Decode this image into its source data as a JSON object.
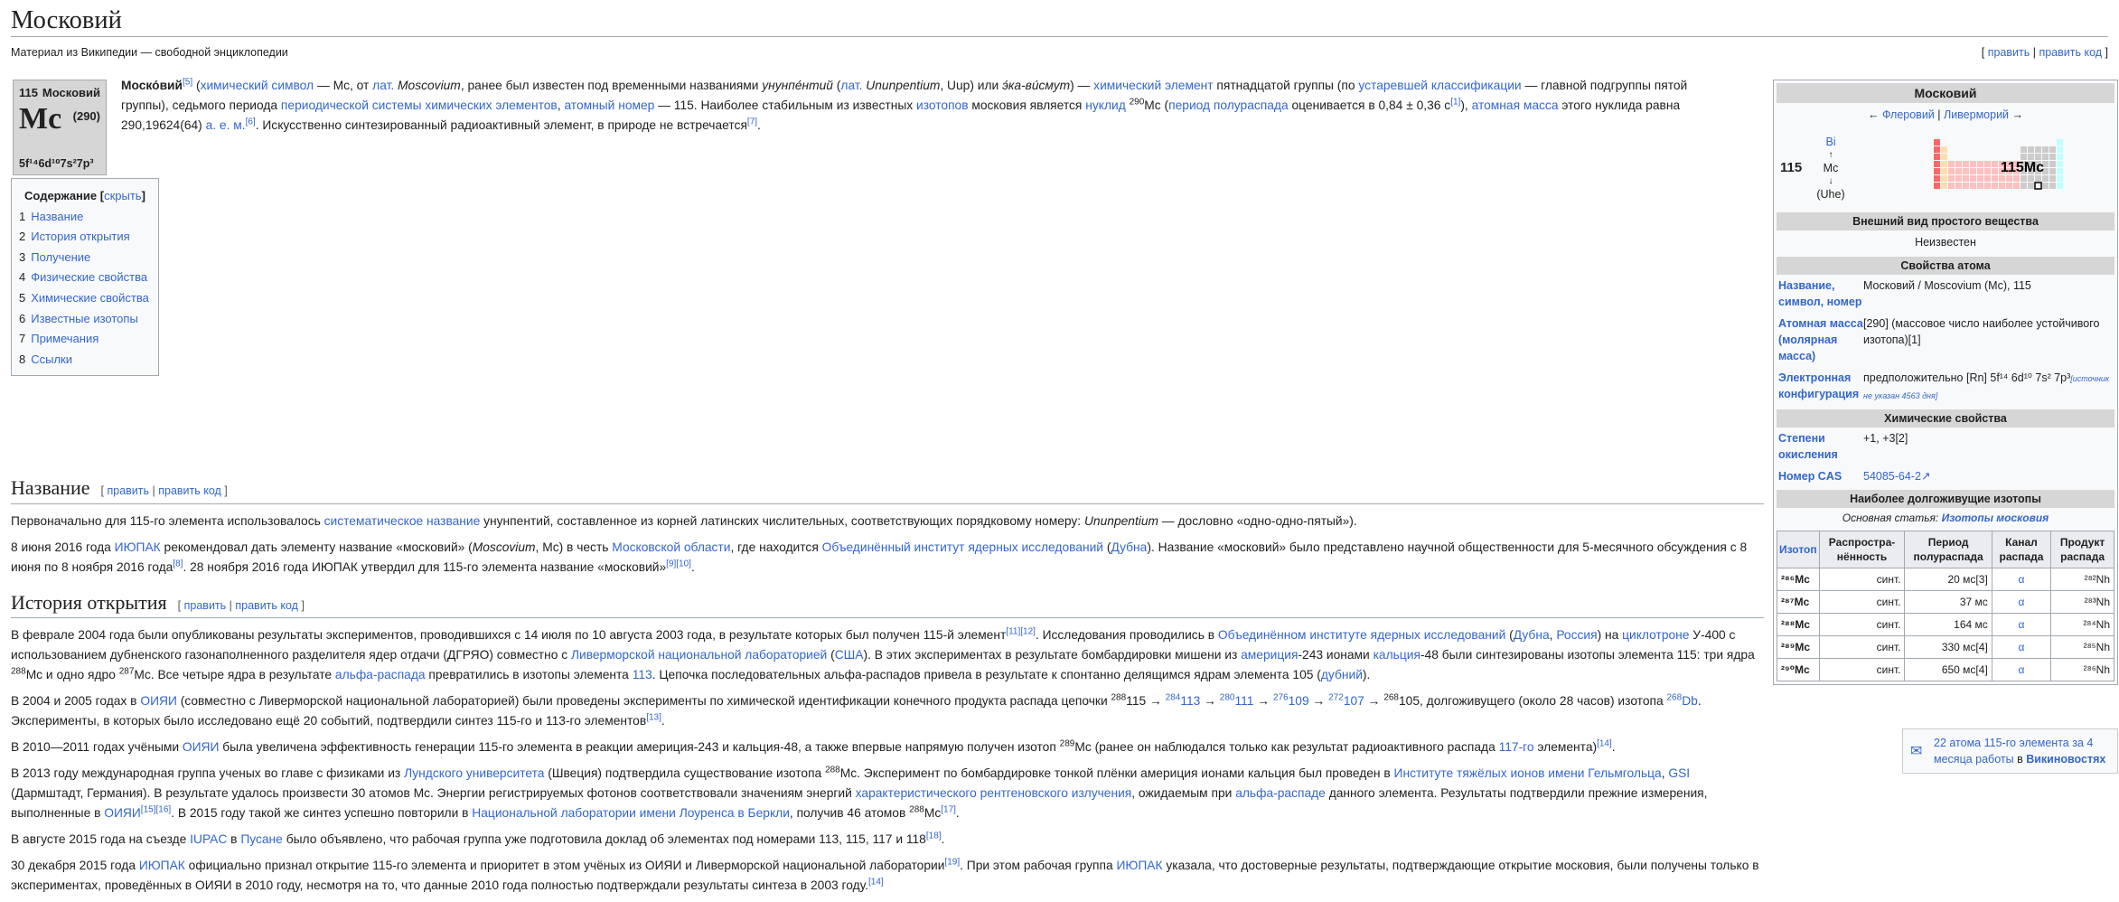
{
  "title": "Московий",
  "tagline": "Материал из Википедии — свободной энциклопедии",
  "edit": {
    "open": "[ ",
    "edit": "править",
    "sep": " | ",
    "edit_code": "править код",
    "close": " ]"
  },
  "cell": {
    "number": "115",
    "name": "Московий",
    "symbol": "Mc",
    "mass": "(290)",
    "config": "5f¹⁴6d¹⁰7s²7p³"
  },
  "intro": {
    "p1": [
      {
        "t": "Моско́вий",
        "b": true
      },
      {
        "t": "[5]",
        "sup": true,
        "l": true
      },
      {
        "t": " ("
      },
      {
        "t": "химический символ",
        "l": true
      },
      {
        "t": " — Mc, от "
      },
      {
        "t": "лат.",
        "l": true
      },
      {
        "t": " Moscovium",
        "i": true
      },
      {
        "t": ", ранее был известен под временными названиями "
      },
      {
        "t": "унунпе́нтий",
        "i": true
      },
      {
        "t": " ("
      },
      {
        "t": "лат.",
        "l": true
      },
      {
        "t": " Ununpentium",
        "i": true
      },
      {
        "t": ", Uup) или "
      },
      {
        "t": "э́ка-ви́смут",
        "i": true
      },
      {
        "t": ") — "
      },
      {
        "t": "химический элемент",
        "l": true
      },
      {
        "t": " пятнадцатой группы (по "
      },
      {
        "t": "устаревшей классификации",
        "l": true
      },
      {
        "t": " — главной подгруппы пятой группы), седьмого периода "
      },
      {
        "t": "периодической системы химических элементов",
        "l": true
      },
      {
        "t": ", "
      },
      {
        "t": "атомный номер",
        "l": true
      },
      {
        "t": " — 115. Наиболее стабильным из известных "
      },
      {
        "t": "изотопов",
        "l": true
      },
      {
        "t": " московия является "
      },
      {
        "t": "нуклид",
        "l": true
      },
      {
        "t": " "
      },
      {
        "t": "290",
        "sup": true
      },
      {
        "t": "Mc ("
      },
      {
        "t": "период полураспада",
        "l": true
      },
      {
        "t": " оценивается в 0,84 ± 0,36 с"
      },
      {
        "t": "[1]",
        "sup": true,
        "l": true
      },
      {
        "t": "), "
      },
      {
        "t": "атомная масса",
        "l": true
      },
      {
        "t": " этого нуклида равна 290,19624(64) "
      },
      {
        "t": "а. е. м.",
        "l": true
      },
      {
        "t": "[6]",
        "sup": true,
        "l": true
      },
      {
        "t": ". Искусственно синтезированный радиоактивный элемент, в природе не встречается"
      },
      {
        "t": "[7]",
        "sup": true,
        "l": true
      },
      {
        "t": "."
      }
    ]
  },
  "toc": {
    "title": "Содержание",
    "hide": "скрыть",
    "items": [
      {
        "n": "1",
        "label": "Название"
      },
      {
        "n": "2",
        "label": "История открытия"
      },
      {
        "n": "3",
        "label": "Получение"
      },
      {
        "n": "4",
        "label": "Физические свойства"
      },
      {
        "n": "5",
        "label": "Химические свойства"
      },
      {
        "n": "6",
        "label": "Известные изотопы"
      },
      {
        "n": "7",
        "label": "Примечания"
      },
      {
        "n": "8",
        "label": "Ссылки"
      }
    ]
  },
  "sec_name": {
    "heading": "Название",
    "p1": [
      {
        "t": "Первоначально для 115-го элемента использовалось "
      },
      {
        "t": "систематическое название",
        "l": true
      },
      {
        "t": " унунпентий, составленное из корней латинских числительных, соответствующих порядковому номеру: "
      },
      {
        "t": "Ununpentium",
        "i": true
      },
      {
        "t": " — дословно «одно-одно-пятый»)."
      }
    ],
    "p2": [
      {
        "t": "8 июня 2016 года "
      },
      {
        "t": "ИЮПАК",
        "l": true
      },
      {
        "t": " рекомендовал дать элементу название «московий» ("
      },
      {
        "t": "Moscovium",
        "i": true
      },
      {
        "t": ", Mc) в честь "
      },
      {
        "t": "Московской области",
        "l": true
      },
      {
        "t": ", где находится "
      },
      {
        "t": "Объединённый институт ядерных исследований",
        "l": true
      },
      {
        "t": " ("
      },
      {
        "t": "Дубна",
        "l": true
      },
      {
        "t": "). Название «московий» было представлено научной общественности для 5-месячного обсуждения с 8 июня по 8 ноября 2016 года"
      },
      {
        "t": "[8]",
        "sup": true,
        "l": true
      },
      {
        "t": ". 28 ноября 2016 года ИЮПАК утвердил для 115-го элемента название «московий»"
      },
      {
        "t": "[9][10]",
        "sup": true,
        "l": true
      },
      {
        "t": "."
      }
    ]
  },
  "sec_hist": {
    "heading": "История открытия",
    "p1": [
      {
        "t": "В феврале 2004 года были опубликованы результаты экспериментов, проводившихся с 14 июля по 10 августа 2003 года, в результате которых был получен 115-й элемент"
      },
      {
        "t": "[11][12]",
        "sup": true,
        "l": true
      },
      {
        "t": ". Исследования проводились в "
      },
      {
        "t": "Объединённом институте ядерных исследований",
        "l": true
      },
      {
        "t": " ("
      },
      {
        "t": "Дубна",
        "l": true
      },
      {
        "t": ", "
      },
      {
        "t": "Россия",
        "l": true
      },
      {
        "t": ") на "
      },
      {
        "t": "циклотроне",
        "l": true
      },
      {
        "t": " У-400 с использованием дубненского газонаполненного разделителя ядер отдачи (ДГРЯО) совместно с "
      },
      {
        "t": "Ливерморской национальной лабораторией",
        "l": true
      },
      {
        "t": " ("
      },
      {
        "t": "США",
        "l": true
      },
      {
        "t": "). В этих экспериментах в результате бомбардировки мишени из "
      },
      {
        "t": "америция",
        "l": true
      },
      {
        "t": "-243 ионами "
      },
      {
        "t": "кальция",
        "l": true
      },
      {
        "t": "-48 были синтезированы изотопы элемента 115: три ядра "
      },
      {
        "t": "288",
        "sup": true
      },
      {
        "t": "Mc и одно ядро "
      },
      {
        "t": "287",
        "sup": true
      },
      {
        "t": "Mc. Все четыре ядра в результате "
      },
      {
        "t": "альфа-распада",
        "l": true
      },
      {
        "t": " превратились в изотопы элемента "
      },
      {
        "t": "113",
        "l": true
      },
      {
        "t": ". Цепочка последовательных альфа-распадов привела в результате к спонтанно делящимся ядрам элемента 105 ("
      },
      {
        "t": "дубний",
        "l": true
      },
      {
        "t": ")."
      }
    ],
    "p2": [
      {
        "t": "В 2004 и 2005 годах в "
      },
      {
        "t": "ОИЯИ",
        "l": true
      },
      {
        "t": " (совместно с Ливерморской национальной лабораторией) были проведены эксперименты по химической идентификации конечного продукта распада цепочки "
      },
      {
        "t": "288",
        "sup": true
      },
      {
        "t": "115 → "
      },
      {
        "t": "284",
        "sup": true,
        "l": true
      },
      {
        "t": "113",
        "l": true
      },
      {
        "t": " → "
      },
      {
        "t": "280",
        "sup": true,
        "l": true
      },
      {
        "t": "111",
        "l": true
      },
      {
        "t": " → "
      },
      {
        "t": "276",
        "sup": true,
        "l": true
      },
      {
        "t": "109",
        "l": true
      },
      {
        "t": " → "
      },
      {
        "t": "272",
        "sup": true,
        "l": true
      },
      {
        "t": "107",
        "l": true
      },
      {
        "t": " → "
      },
      {
        "t": "268",
        "sup": true
      },
      {
        "t": "105, долгоживущего (около 28 часов) изотопа "
      },
      {
        "t": "268",
        "sup": true,
        "l": true
      },
      {
        "t": "Db",
        "l": true
      },
      {
        "t": ". Эксперименты, в которых было исследовано ещё 20 событий, подтвердили синтез 115-го и 113-го элементов"
      },
      {
        "t": "[13]",
        "sup": true,
        "l": true
      },
      {
        "t": "."
      }
    ],
    "p3": [
      {
        "t": "В 2010—2011 годах учёными "
      },
      {
        "t": "ОИЯИ",
        "l": true
      },
      {
        "t": " была увеличена эффективность генерации 115-го элемента в реакции америция-243 и кальция-48, а также впервые напрямую получен изотоп "
      },
      {
        "t": "289",
        "sup": true
      },
      {
        "t": "Mc (ранее он наблюдался только как результат радиоактивного распада "
      },
      {
        "t": "117-го",
        "l": true
      },
      {
        "t": " элемента)"
      },
      {
        "t": "[14]",
        "sup": true,
        "l": true
      },
      {
        "t": "."
      }
    ],
    "p4": [
      {
        "t": "В 2013 году международная группа ученых во главе с физиками из "
      },
      {
        "t": "Лундского университета",
        "l": true
      },
      {
        "t": " (Швеция) подтвердила существование изотопа "
      },
      {
        "t": "288",
        "sup": true
      },
      {
        "t": "Mc. Эксперимент по бомбардировке тонкой плёнки америция ионами кальция был проведен в "
      },
      {
        "t": "Институте тяжёлых ионов имени Гельмгольца",
        "l": true
      },
      {
        "t": ", "
      },
      {
        "t": "GSI",
        "l": true
      },
      {
        "t": " (Дармштадт, Германия). В результате удалось произвести 30 атомов Mc. Энергии регистрируемых фотонов соответствовали значениям энергий "
      },
      {
        "t": "характеристического рентгеновского излучения",
        "l": true
      },
      {
        "t": ", ожидаемым при "
      },
      {
        "t": "альфа-распаде",
        "l": true
      },
      {
        "t": " данного элемента. Результаты подтвердили прежние измерения, выполненные в "
      },
      {
        "t": "ОИЯИ",
        "l": true
      },
      {
        "t": "[15][16]",
        "sup": true,
        "l": true
      },
      {
        "t": ". В 2015 году такой же синтез успешно повторили в "
      },
      {
        "t": "Национальной лаборатории имени Лоуренса в Беркли",
        "l": true
      },
      {
        "t": ", получив 46 атомов "
      },
      {
        "t": "288",
        "sup": true
      },
      {
        "t": "Mc"
      },
      {
        "t": "[17]",
        "sup": true,
        "l": true
      },
      {
        "t": "."
      }
    ],
    "p5": [
      {
        "t": "В августе 2015 года на съезде "
      },
      {
        "t": "IUPAC",
        "l": true
      },
      {
        "t": " в "
      },
      {
        "t": "Пусане",
        "l": true
      },
      {
        "t": " было объявлено, что рабочая группа уже подготовила доклад об элементах под номерами 113, 115, 117 и 118"
      },
      {
        "t": "[18]",
        "sup": true,
        "l": true
      },
      {
        "t": "."
      }
    ],
    "p6": [
      {
        "t": "30 декабря 2015 года "
      },
      {
        "t": "ИЮПАК",
        "l": true
      },
      {
        "t": " официально признал открытие 115-го элемента и приоритет в этом учёных из ОИЯИ и Ливерморской национальной лаборатории"
      },
      {
        "t": "[19]",
        "sup": true,
        "l": true
      },
      {
        "t": ". При этом рабочая группа "
      },
      {
        "t": "ИЮПАК",
        "l": true
      },
      {
        "t": " указала, что достоверные результаты, подтверждающие открытие московия, были получены только в экспериментах, проведённых в ОИЯИ в 2010 году, несмотря на то, что данные 2010 года полностью подтверждали результаты синтеза в 2003 году."
      },
      {
        "t": "[14]",
        "sup": true,
        "l": true
      }
    ]
  },
  "infobox": {
    "title": "Московий",
    "nav": "← Флеровий | Ливерморий →",
    "nav_prev": "Флеровий",
    "nav_next": "Ливерморий",
    "num": "115",
    "above": "Bi",
    "self": "Mc",
    "below": "(Uhe)",
    "mini_label": "115Mc",
    "sec_appearance": "Внешний вид простого вещества",
    "appearance": "Неизвестен",
    "sec_atom": "Свойства атома",
    "rows": [
      {
        "k": "Название, символ, номер",
        "v": "Московий / Moscovium (Mc), 115"
      },
      {
        "k": "Атомная масса (молярная масса)",
        "v": "[290] (массовое число наиболее устойчивого изотопа)[1]"
      },
      {
        "k": "Электронная конфигурация",
        "v": "предположительно [Rn] 5f¹⁴ 6d¹⁰ 7s² 7p³",
        "note": "[источник не указан 4563 дня]"
      }
    ],
    "sec_chem": "Химические свойства",
    "rows2": [
      {
        "k": "Степени окисления",
        "v": "+1, +3[2]"
      },
      {
        "k": "Номер CAS",
        "v": "54085-64-2↗"
      }
    ],
    "sec_iso": "Наиболее долгоживущие изотопы",
    "iso_main_prefix": "Основная статья: ",
    "iso_main_link": "Изотопы московия",
    "iso_head": [
      "Изотоп",
      "Распростра-нённость",
      "Период полураспада",
      "Канал распада",
      "Продукт распада"
    ],
    "isotopes": [
      {
        "iso": "²⁸⁶Mc",
        "ab": "синт.",
        "hl": "20 мс[3]",
        "ch": "α",
        "pr": "²⁸²Nh"
      },
      {
        "iso": "²⁸⁷Mc",
        "ab": "синт.",
        "hl": "37 мс",
        "ch": "α",
        "pr": "²⁸³Nh"
      },
      {
        "iso": "²⁸⁸Mc",
        "ab": "синт.",
        "hl": "164 мс",
        "ch": "α",
        "pr": "²⁸⁴Nh"
      },
      {
        "iso": "²⁸⁹Mc",
        "ab": "синт.",
        "hl": "330 мс[4]",
        "ch": "α",
        "pr": "²⁸⁵Nh"
      },
      {
        "iso": "²⁹⁰Mc",
        "ab": "синт.",
        "hl": "650 мс[4]",
        "ch": "α",
        "pr": "²⁸⁶Nh"
      }
    ]
  },
  "news": {
    "text": "22 атома 115-го элемента за 4 месяца работы",
    "suffix_pre": " в ",
    "suffix": "Викиновостях"
  }
}
